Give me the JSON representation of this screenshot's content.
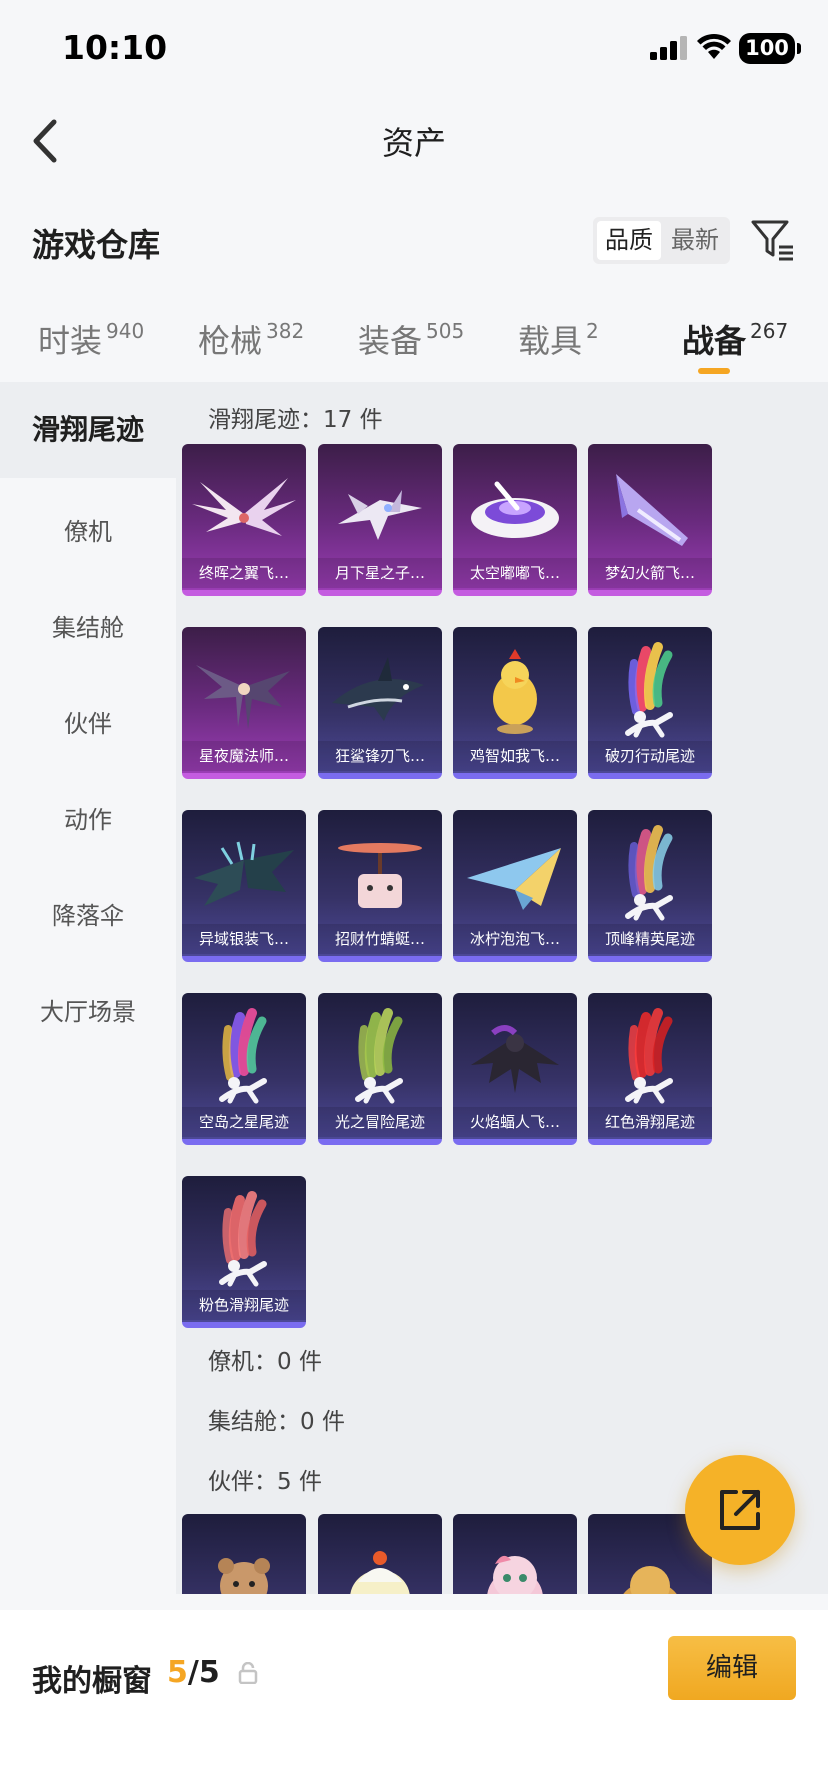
{
  "status_bar": {
    "time": "10:10",
    "battery": "100"
  },
  "nav": {
    "title": "资产"
  },
  "warehouse": {
    "title": "游戏仓库",
    "sort": {
      "active": "品质",
      "inactive": "最新"
    }
  },
  "tabs": [
    {
      "label": "时装",
      "count": "940"
    },
    {
      "label": "枪械",
      "count": "382"
    },
    {
      "label": "装备",
      "count": "505"
    },
    {
      "label": "载具",
      "count": "2"
    },
    {
      "label": "战备",
      "count": "267"
    }
  ],
  "sidebar": {
    "items": [
      {
        "label": "滑翔尾迹"
      },
      {
        "label": "僚机"
      },
      {
        "label": "集结舱"
      },
      {
        "label": "伙伴"
      },
      {
        "label": "动作"
      },
      {
        "label": "降落伞"
      },
      {
        "label": "大厅场景"
      }
    ]
  },
  "groups": {
    "trails": {
      "label": "滑翔尾迹：17 件"
    },
    "wingman": {
      "label": "僚机：0 件"
    },
    "pod": {
      "label": "集结舱：0 件"
    },
    "partner": {
      "label": "伙伴：5 件"
    }
  },
  "items": [
    {
      "name": "终晖之翼飞…",
      "rarity": "purple",
      "icon": "wings-icon"
    },
    {
      "name": "月下星之子…",
      "rarity": "purple",
      "icon": "jet-icon"
    },
    {
      "name": "太空嘟嘟飞…",
      "rarity": "purple",
      "icon": "saucer-icon"
    },
    {
      "name": "梦幻火箭飞…",
      "rarity": "purple",
      "icon": "rocket-glider-icon"
    },
    {
      "name": "星夜魔法师…",
      "rarity": "purple",
      "icon": "dark-wings-icon"
    },
    {
      "name": "狂鲨锋刃飞…",
      "rarity": "blue",
      "icon": "shark-glider-icon"
    },
    {
      "name": "鸡智如我飞…",
      "rarity": "blue",
      "icon": "chicken-icon"
    },
    {
      "name": "破刃行动尾迹",
      "rarity": "blue",
      "icon": "smoke-trail-icon",
      "smoke": [
        "#ff4d6a",
        "#ffd34d",
        "#4dd08c",
        "#7c6cff"
      ]
    },
    {
      "name": "异域银装飞…",
      "rarity": "blue",
      "icon": "armor-wings-icon"
    },
    {
      "name": "招财竹蜻蜓…",
      "rarity": "blue",
      "icon": "copter-icon"
    },
    {
      "name": "冰柠泡泡飞…",
      "rarity": "blue",
      "icon": "paper-plane-icon"
    },
    {
      "name": "顶峰精英尾迹",
      "rarity": "blue",
      "icon": "smoke-trail-icon",
      "smoke": [
        "#e05a8a",
        "#f0c050",
        "#8ad0e8",
        "#6a5fd8"
      ]
    },
    {
      "name": "空岛之星尾迹",
      "rarity": "blue",
      "icon": "smoke-trail-icon",
      "smoke": [
        "#8a5cf0",
        "#f04f9c",
        "#55d0a0",
        "#f0c040"
      ]
    },
    {
      "name": "光之冒险尾迹",
      "rarity": "blue",
      "icon": "smoke-trail-icon",
      "smoke": [
        "#9bc44a",
        "#b8d35a",
        "#8cb840",
        "#a8c84c"
      ]
    },
    {
      "name": "火焰蝠人飞…",
      "rarity": "blue",
      "icon": "batman-icon"
    },
    {
      "name": "红色滑翔尾迹",
      "rarity": "blue",
      "icon": "smoke-trail-icon",
      "smoke": [
        "#e52a2a",
        "#f03a3a",
        "#d82020",
        "#ff4040"
      ]
    },
    {
      "name": "粉色滑翔尾迹",
      "rarity": "blue",
      "icon": "smoke-trail-icon",
      "smoke": [
        "#f06a6a",
        "#f58080",
        "#e86060",
        "#f07070"
      ]
    }
  ],
  "partners": [
    {
      "icon": "bear-partner-icon"
    },
    {
      "icon": "chick-partner-icon"
    },
    {
      "icon": "pink-partner-icon"
    },
    {
      "icon": "cat-partner-icon"
    }
  ],
  "showcase": {
    "label": "我的橱窗",
    "used": "5",
    "total": "/5",
    "edit_label": "编辑"
  },
  "colors": {
    "accent": "#f5a623",
    "purple_rarity": "#c45ce0",
    "blue_rarity": "#7a6cf0"
  }
}
